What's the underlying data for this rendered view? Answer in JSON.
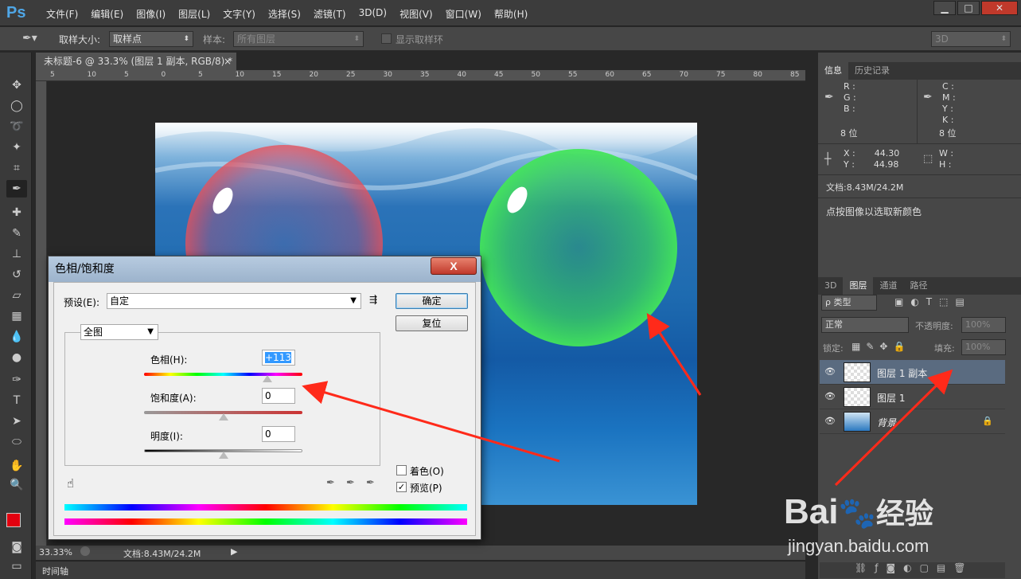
{
  "app": {
    "logo": "Ps"
  },
  "menu": [
    "文件(F)",
    "编辑(E)",
    "图像(I)",
    "图层(L)",
    "文字(Y)",
    "选择(S)",
    "滤镜(T)",
    "3D(D)",
    "视图(V)",
    "窗口(W)",
    "帮助(H)"
  ],
  "window_controls": {
    "minimize": "▁",
    "maximize": "□",
    "close": "✕"
  },
  "options": {
    "sample_size_label": "取样大小:",
    "sample_size_value": "取样点",
    "sample_label": "样本:",
    "sample_value": "所有图层",
    "show_ring": "显示取样环",
    "workspace": "3D"
  },
  "document": {
    "tab_title": "未标题-6 @ 33.3% (图层 1 副本, RGB/8) *",
    "close": "×"
  },
  "ruler_ticks": [
    "5",
    "10",
    "5",
    "0",
    "5",
    "10",
    "15",
    "20",
    "25",
    "30",
    "35",
    "40",
    "45",
    "50",
    "55",
    "60",
    "65",
    "70",
    "75",
    "80",
    "85"
  ],
  "status": {
    "zoom": "33.33%",
    "doc": "文档:8.43M/24.2M"
  },
  "timeline": "时间轴",
  "info_panel": {
    "tabs": [
      "信息",
      "历史记录"
    ],
    "rgb": [
      "R :",
      "G :",
      "B :"
    ],
    "cmyk": [
      "C :",
      "M :",
      "Y :",
      "K :"
    ],
    "bits_left": "8 位",
    "bits_right": "8 位",
    "x_label": "X :",
    "x_value": "44.30",
    "y_label": "Y :",
    "y_value": "44.98",
    "w_label": "W :",
    "h_label": "H :",
    "doc": "文档:8.43M/24.2M",
    "hint": "点按图像以选取新颜色"
  },
  "layers_panel": {
    "tabs": [
      "3D",
      "图层",
      "通道",
      "路径"
    ],
    "kind": "ρ 类型",
    "blend": "正常",
    "opacity_label": "不透明度:",
    "opacity": "100%",
    "lock_label": "锁定:",
    "fill_label": "填充:",
    "fill": "100%",
    "layers": [
      {
        "name": "图层 1 副本"
      },
      {
        "name": "图层 1"
      },
      {
        "name": "背景"
      }
    ]
  },
  "dialog": {
    "title": "色相/饱和度",
    "close": "X",
    "preset_label": "预设(E):",
    "preset_value": "自定",
    "ok": "确定",
    "reset": "复位",
    "channel": "全图",
    "hue_label": "色相(H):",
    "hue_value": "+113",
    "sat_label": "饱和度(A):",
    "sat_value": "0",
    "light_label": "明度(I):",
    "light_value": "0",
    "colorize": "着色(O)",
    "preview": "预览(P)",
    "hue_level": 0.78,
    "sat_level": 0.5,
    "light_level": 0.5
  },
  "watermark": {
    "text": "Bai",
    "text2": "经验",
    "url": "jingyan.baidu.com"
  },
  "colors": {
    "accent": "#4fa6e6",
    "fg": "#e3000f",
    "bg": "#ffffff",
    "red_bubble": "#d94a6a",
    "green_bubble": "#3fdc5a",
    "arrow": "#ff2a1a"
  }
}
